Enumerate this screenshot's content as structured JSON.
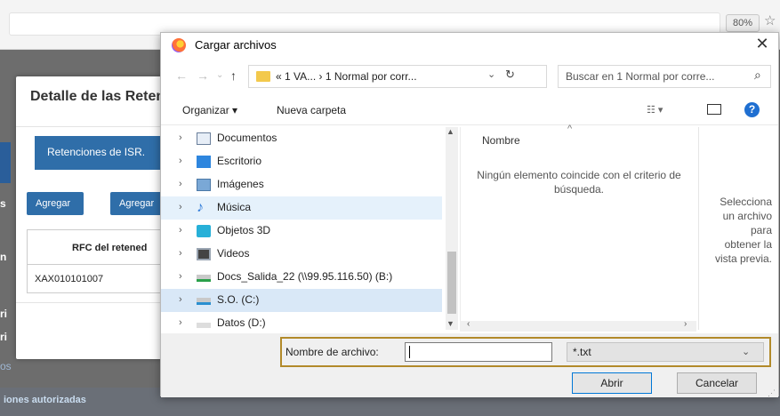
{
  "browser": {
    "zoom": "80%"
  },
  "page": {
    "nav_fragments": [
      "s",
      "n",
      "ri",
      "ri",
      "os"
    ],
    "footer_text": "iones autorizadas"
  },
  "modal": {
    "title": "Detalle de las Reten",
    "tab_label": "Retenciones de ISR.",
    "add_buttons": [
      "Agregar",
      "Agregar"
    ],
    "table": {
      "header": "RFC del retened",
      "rows": [
        "XAX010101007"
      ]
    }
  },
  "dialog": {
    "title": "Cargar archivos",
    "close_glyph": "✕",
    "address": {
      "prefix": "«",
      "path_1": "1 VA...",
      "separator": "›",
      "path_2": "1 Normal por corr..."
    },
    "search_placeholder": "Buscar en 1 Normal por corre...",
    "toolbar": {
      "organize": "Organizar ▾",
      "new_folder": "Nueva carpeta",
      "view_glyph": "☷ ▾"
    },
    "tree": [
      {
        "label": "Documentos",
        "icon": "document-icon"
      },
      {
        "label": "Escritorio",
        "icon": "desktop-icon"
      },
      {
        "label": "Imágenes",
        "icon": "images-icon"
      },
      {
        "label": "Música",
        "icon": "music-icon"
      },
      {
        "label": "Objetos 3D",
        "icon": "3d-objects-icon"
      },
      {
        "label": "Videos",
        "icon": "videos-icon"
      },
      {
        "label": "Docs_Salida_22 (\\\\99.95.116.50) (B:)",
        "icon": "network-drive-icon"
      },
      {
        "label": "S.O. (C:)",
        "icon": "drive-icon"
      },
      {
        "label": "Datos (D:)",
        "icon": "drive-icon"
      }
    ],
    "content": {
      "column_header": "Nombre",
      "empty_message_1": "Ningún elemento coincide con el criterio de",
      "empty_message_2": "búsqueda."
    },
    "preview": [
      "Selecciona",
      "un archivo",
      "para",
      "obtener la",
      "vista previa."
    ],
    "bottom": {
      "filename_label": "Nombre de archivo:",
      "filename_value": "",
      "filetype_value": "*.txt",
      "open_label": "Abrir",
      "cancel_label": "Cancelar"
    }
  }
}
